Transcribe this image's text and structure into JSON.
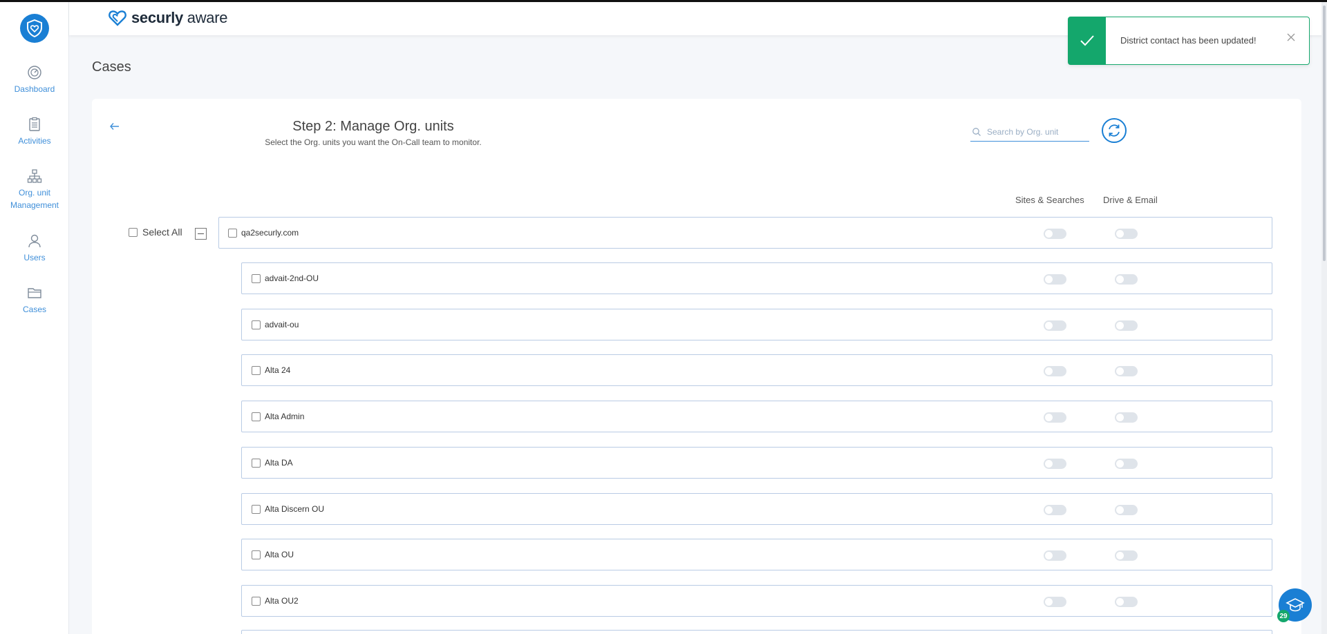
{
  "brand": {
    "name_bold": "securly",
    "name_light": " aware"
  },
  "sidebar": {
    "items": [
      {
        "label": "Dashboard",
        "icon": "gauge-icon"
      },
      {
        "label": "Activities",
        "icon": "clipboard-icon"
      },
      {
        "label": "Org. unit Management",
        "icon": "org-chart-icon"
      },
      {
        "label": "Users",
        "icon": "user-icon"
      },
      {
        "label": "Cases",
        "icon": "folder-icon"
      }
    ]
  },
  "page": {
    "title": "Cases"
  },
  "step": {
    "title": "Step 2: Manage Org. units",
    "subtitle": "Select the Org. units you want the On-Call team to monitor."
  },
  "search": {
    "placeholder": "Search by Org. unit",
    "value": ""
  },
  "columns": {
    "sites": "Sites & Searches",
    "drive": "Drive & Email"
  },
  "select_all": {
    "label": "Select All"
  },
  "root_unit": {
    "label": "qa2securly.com",
    "sites_on": false,
    "drive_on": false
  },
  "units": [
    {
      "label": "advait-2nd-OU",
      "sites_on": false,
      "drive_on": false
    },
    {
      "label": "advait-ou",
      "sites_on": false,
      "drive_on": false
    },
    {
      "label": "Alta 24",
      "sites_on": false,
      "drive_on": false
    },
    {
      "label": "Alta Admin",
      "sites_on": false,
      "drive_on": false
    },
    {
      "label": "Alta DA",
      "sites_on": false,
      "drive_on": false
    },
    {
      "label": "Alta Discern OU",
      "sites_on": false,
      "drive_on": false
    },
    {
      "label": "Alta OU",
      "sites_on": false,
      "drive_on": false
    },
    {
      "label": "Alta OU2",
      "sites_on": false,
      "drive_on": false
    }
  ],
  "toast": {
    "message": "District contact has been updated!"
  },
  "help": {
    "badge": "29"
  },
  "colors": {
    "primary": "#1a7fd4",
    "success": "#14a76c",
    "row_border": "#b9cbe4"
  }
}
